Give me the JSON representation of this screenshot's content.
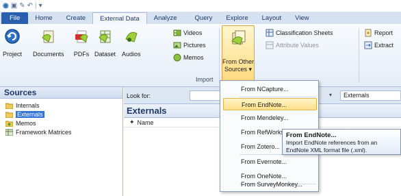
{
  "quick_access": {
    "icons": [
      "app-logo-icon",
      "save-icon",
      "edit-icon",
      "undo-icon"
    ]
  },
  "tabs": [
    {
      "label": "File"
    },
    {
      "label": "Home"
    },
    {
      "label": "Create"
    },
    {
      "label": "External Data"
    },
    {
      "label": "Analyze"
    },
    {
      "label": "Query"
    },
    {
      "label": "Explore"
    },
    {
      "label": "Layout"
    },
    {
      "label": "View"
    }
  ],
  "ribbon": {
    "large_buttons": [
      {
        "label": "Project",
        "icon": "project-import-icon"
      },
      {
        "label": "Documents",
        "icon": "documents-icon"
      },
      {
        "label": "PDFs",
        "icon": "pdf-icon"
      },
      {
        "label": "Dataset",
        "icon": "dataset-icon"
      },
      {
        "label": "Audios",
        "icon": "audio-icon"
      }
    ],
    "small_buttons": [
      {
        "label": "Videos",
        "icon": "video-icon"
      },
      {
        "label": "Pictures",
        "icon": "pictures-icon"
      },
      {
        "label": "Memos",
        "icon": "memos-icon"
      }
    ],
    "group_label": "Import",
    "from_other_sources": {
      "line1": "From Other",
      "line2": "Sources ▾",
      "icon": "from-other-sources-icon"
    },
    "right_buttons": [
      {
        "label": "Classification Sheets",
        "icon": "classification-sheets-icon",
        "enabled": true
      },
      {
        "label": "Attribute Values",
        "icon": "attribute-values-icon",
        "enabled": false
      },
      {
        "label": "Report",
        "icon": "report-icon",
        "enabled": true
      },
      {
        "label": "Extract",
        "icon": "extract-icon",
        "enabled": true
      }
    ]
  },
  "sources": {
    "title": "Sources",
    "items": [
      {
        "label": "Internals",
        "icon": "folder-icon"
      },
      {
        "label": "Externals",
        "icon": "folder-icon",
        "selected": true
      },
      {
        "label": "Memos",
        "icon": "memos-folder-icon"
      },
      {
        "label": "Framework Matrices",
        "icon": "framework-matrices-icon"
      }
    ]
  },
  "find_bar": {
    "look_for_label": "Look for:",
    "search_in_value": "Externals"
  },
  "list_view": {
    "title": "Externals",
    "columns": [
      "Name"
    ]
  },
  "dropdown_menu": {
    "items": [
      {
        "label": "From NCapture..."
      },
      {
        "label": "From EndNote...",
        "highlighted": true
      },
      {
        "label": "From Mendeley..."
      },
      {
        "label": "From RefWorks..."
      },
      {
        "label": "From Zotero..."
      },
      {
        "label": "From Evernote..."
      },
      {
        "label": "From OneNote..."
      },
      {
        "label": "From SurveyMonkey..."
      }
    ]
  },
  "tooltip": {
    "title": "From EndNote...",
    "body_line1": "Import EndNote references from an",
    "body_line2": "EndNote XML format file (.xml)."
  },
  "colors": {
    "file_tab": "#2a5fb0",
    "selection": "#3375d6",
    "highlight": "#ffe08a",
    "pane_header_text": "#1e3968"
  }
}
